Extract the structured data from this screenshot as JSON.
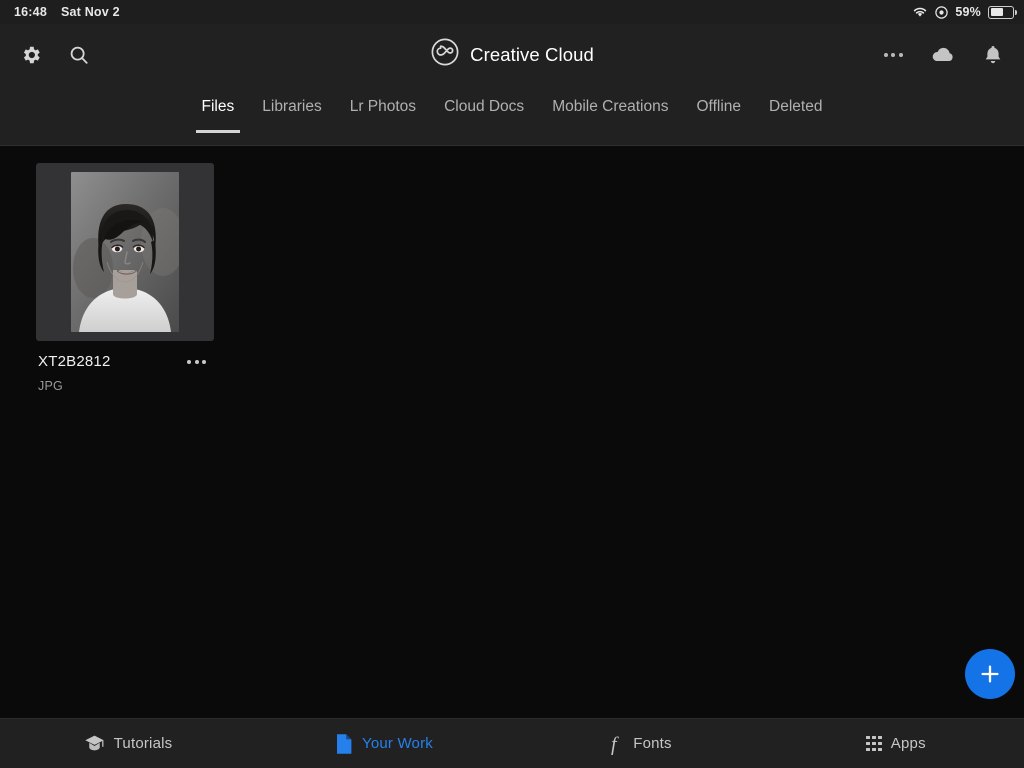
{
  "status_bar": {
    "time": "16:48",
    "date": "Sat Nov 2",
    "battery_percent": "59%",
    "battery_level": 59,
    "icons": [
      "wifi-icon",
      "rotation-lock-icon",
      "battery-icon"
    ]
  },
  "header": {
    "title": "Creative Cloud",
    "logo": "creative-cloud-logo",
    "left_icons": [
      {
        "name": "gear-icon",
        "label": "Settings"
      },
      {
        "name": "search-icon",
        "label": "Search"
      }
    ],
    "right_icons": [
      {
        "name": "more-icon",
        "label": "More"
      },
      {
        "name": "cloud-icon",
        "label": "Cloud sync"
      },
      {
        "name": "bell-icon",
        "label": "Notifications"
      }
    ]
  },
  "tabs": [
    {
      "label": "Files",
      "active": true
    },
    {
      "label": "Libraries",
      "active": false
    },
    {
      "label": "Lr Photos",
      "active": false
    },
    {
      "label": "Cloud Docs",
      "active": false
    },
    {
      "label": "Mobile Creations",
      "active": false
    },
    {
      "label": "Offline",
      "active": false
    },
    {
      "label": "Deleted",
      "active": false
    }
  ],
  "files": [
    {
      "name": "XT2B2812",
      "type": "JPG",
      "thumbnail": "portrait-photo-black-and-white"
    }
  ],
  "fab": {
    "label": "+",
    "name": "add-button",
    "color": "#1473e6"
  },
  "bottom_nav": [
    {
      "label": "Tutorials",
      "icon": "graduation-cap-icon",
      "active": false
    },
    {
      "label": "Your Work",
      "icon": "document-icon",
      "active": true
    },
    {
      "label": "Fonts",
      "icon": "font-f-icon",
      "active": false
    },
    {
      "label": "Apps",
      "icon": "apps-grid-icon",
      "active": false
    }
  ],
  "colors": {
    "accent": "#2680eb",
    "fab": "#1473e6",
    "header_bg": "#212121",
    "content_bg": "#0a0a0a",
    "card_bg": "#333336",
    "text_primary": "#ffffff",
    "text_secondary": "#b0b0b0"
  }
}
